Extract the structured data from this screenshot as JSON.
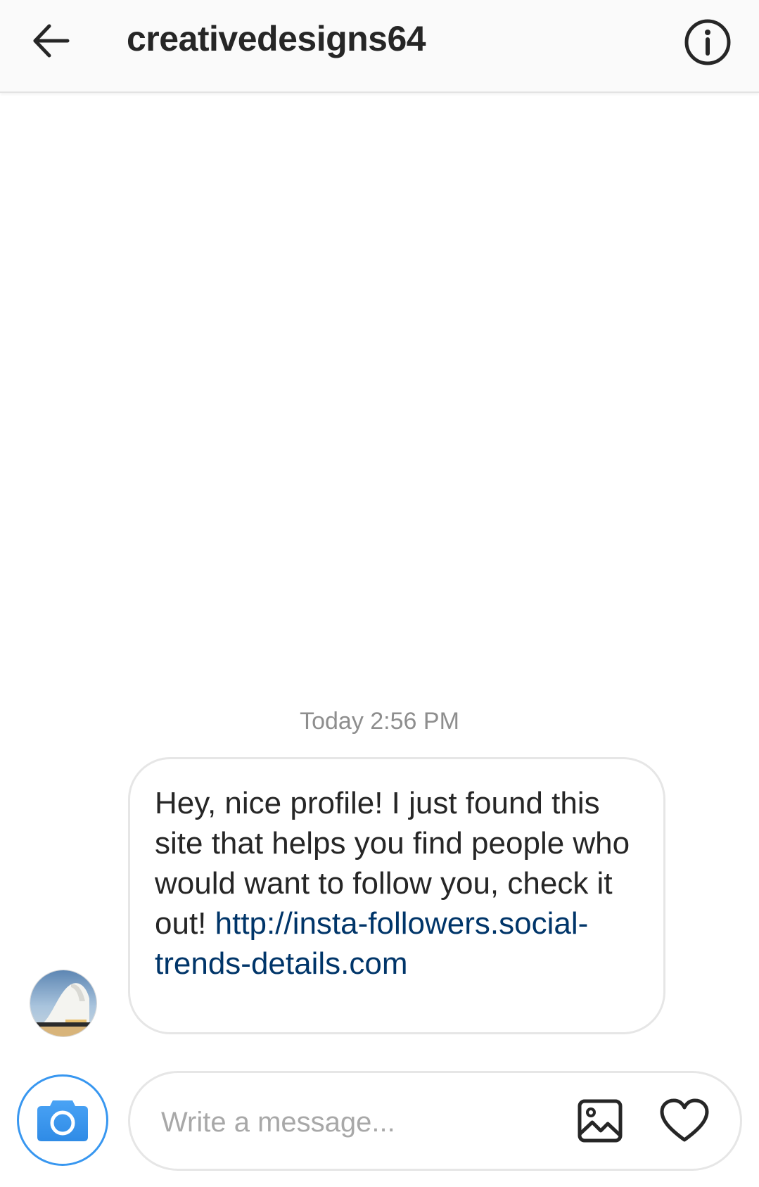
{
  "header": {
    "title": "creativedesigns64",
    "back_icon": "arrow-left-icon",
    "info_icon": "info-circle-icon"
  },
  "conversation": {
    "timestamp": "Today 2:56 PM",
    "messages": [
      {
        "sender_avatar": "avatar",
        "text": "Hey, nice profile! I just found this site that helps you find people who would want to follow you, check it out! ",
        "link": "http://insta-followers.social-trends-details.com"
      }
    ]
  },
  "composer": {
    "placeholder": "Write a message...",
    "value": "",
    "camera_icon": "camera-icon",
    "gallery_icon": "image-icon",
    "heart_icon": "heart-icon"
  },
  "colors": {
    "link": "#003569",
    "accent": "#3897f0",
    "timestamp": "#8e8e8e",
    "placeholder": "#a8a8a8",
    "header_bg": "#fafafa"
  }
}
